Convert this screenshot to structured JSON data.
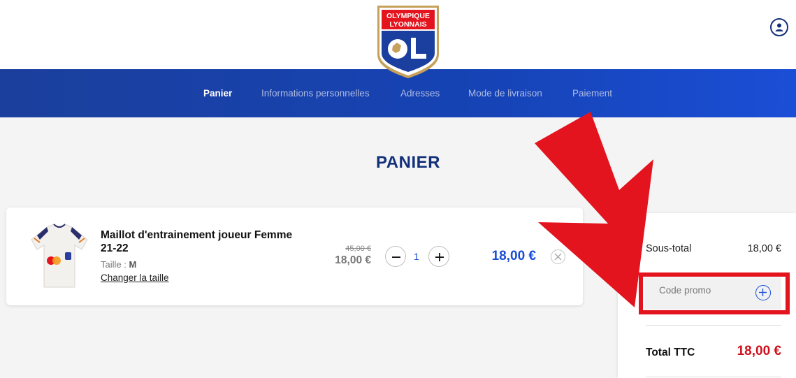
{
  "brand": {
    "logo_line1": "OLYMPIQUE",
    "logo_line2": "LYONNAIS",
    "logo_mark": "OL",
    "colors": {
      "red": "#e3141e",
      "blue": "#1a3f9e",
      "gold": "#c6a15b"
    }
  },
  "header": {
    "account_icon": "user-circle-icon"
  },
  "steps": [
    {
      "label": "Panier",
      "active": true
    },
    {
      "label": "Informations personnelles",
      "active": false
    },
    {
      "label": "Adresses",
      "active": false
    },
    {
      "label": "Mode de livraison",
      "active": false
    },
    {
      "label": "Paiement",
      "active": false
    }
  ],
  "page": {
    "title": "PANIER"
  },
  "cart": {
    "items": [
      {
        "name": "Maillot d'entrainement joueur Femme 21-22",
        "size_label": "Taille : ",
        "size_value": "M",
        "change_size": "Changer la taille",
        "old_price": "45,00 €",
        "unit_price": "18,00 €",
        "quantity": "1",
        "line_total": "18,00 €"
      }
    ]
  },
  "summary": {
    "subtotal_label": "Sous-total",
    "subtotal_value": "18,00 €",
    "promo_placeholder": "Code promo",
    "total_label": "Total TTC",
    "total_value": "18,00 €"
  },
  "annotation": {
    "color": "#e3141e",
    "target": "promo-code-field"
  }
}
